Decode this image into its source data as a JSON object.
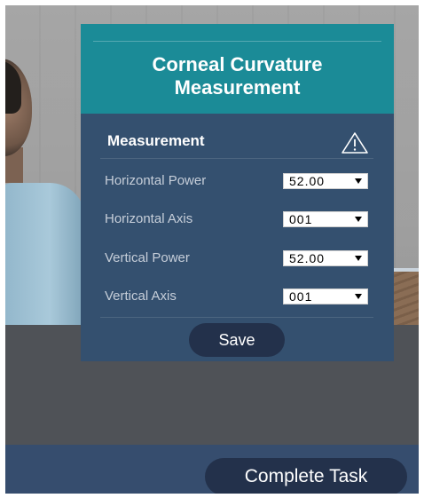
{
  "panel": {
    "title_line1": "Corneal Curvature",
    "title_line2": "Measurement",
    "section_title": "Measurement",
    "warning_icon": "warning-triangle-icon",
    "fields": [
      {
        "label": "Horizontal Power",
        "value": "52.00"
      },
      {
        "label": "Horizontal Axis",
        "value": "001"
      },
      {
        "label": "Vertical Power",
        "value": "52.00"
      },
      {
        "label": "Vertical Axis",
        "value": "001"
      }
    ],
    "save_label": "Save"
  },
  "footer": {
    "complete_label": "Complete Task"
  },
  "colors": {
    "header_teal": "#1b8b97",
    "panel_navy": "#34506f",
    "button_dark": "#23314b",
    "bottom_bar": "#364d6e"
  }
}
